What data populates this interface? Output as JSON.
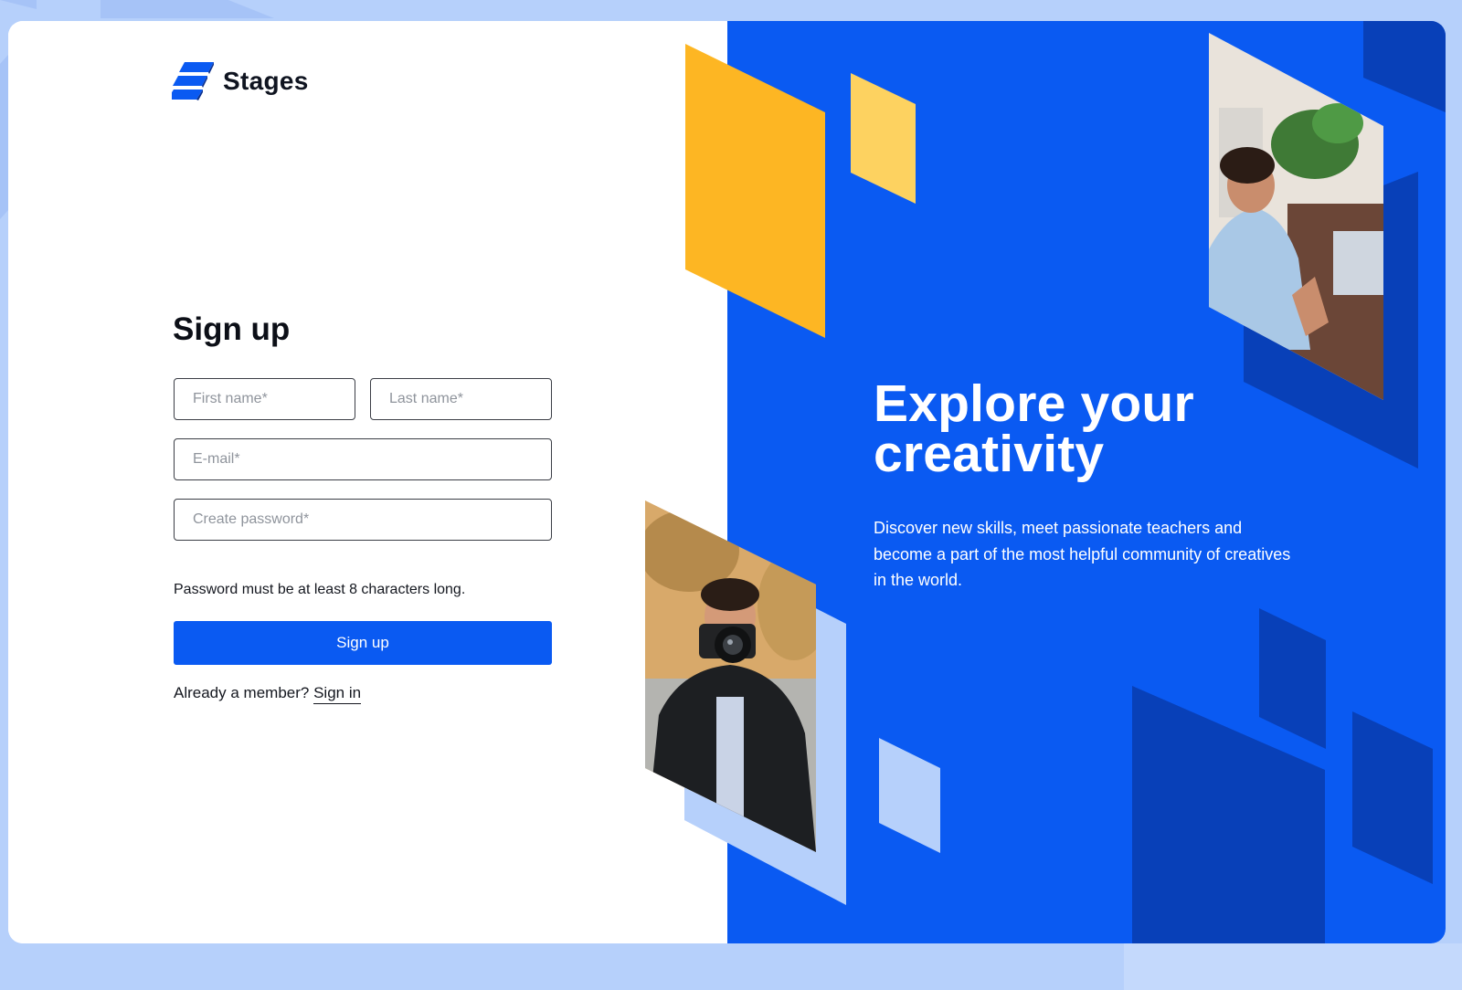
{
  "brand": {
    "name": "Stages"
  },
  "signup": {
    "title": "Sign up",
    "first_name_placeholder": "First name*",
    "last_name_placeholder": "Last name*",
    "email_placeholder": "E-mail*",
    "password_placeholder": "Create password*",
    "password_hint": "Password must be at least 8 characters long.",
    "submit_label": "Sign up",
    "member_prompt": "Already a member?",
    "signin_link": "Sign in"
  },
  "hero": {
    "headline_line1": "Explore your",
    "headline_line2": "creativity",
    "body": "Discover new skills, meet passionate teachers and become a part of the most helpful community of creatives in the world."
  },
  "colors": {
    "brand_blue": "#0a5af2",
    "dark_blue": "#0840b8",
    "light_blue": "#b6d0fb",
    "yellow": "#fdb623",
    "light_yellow": "#fdd260"
  }
}
